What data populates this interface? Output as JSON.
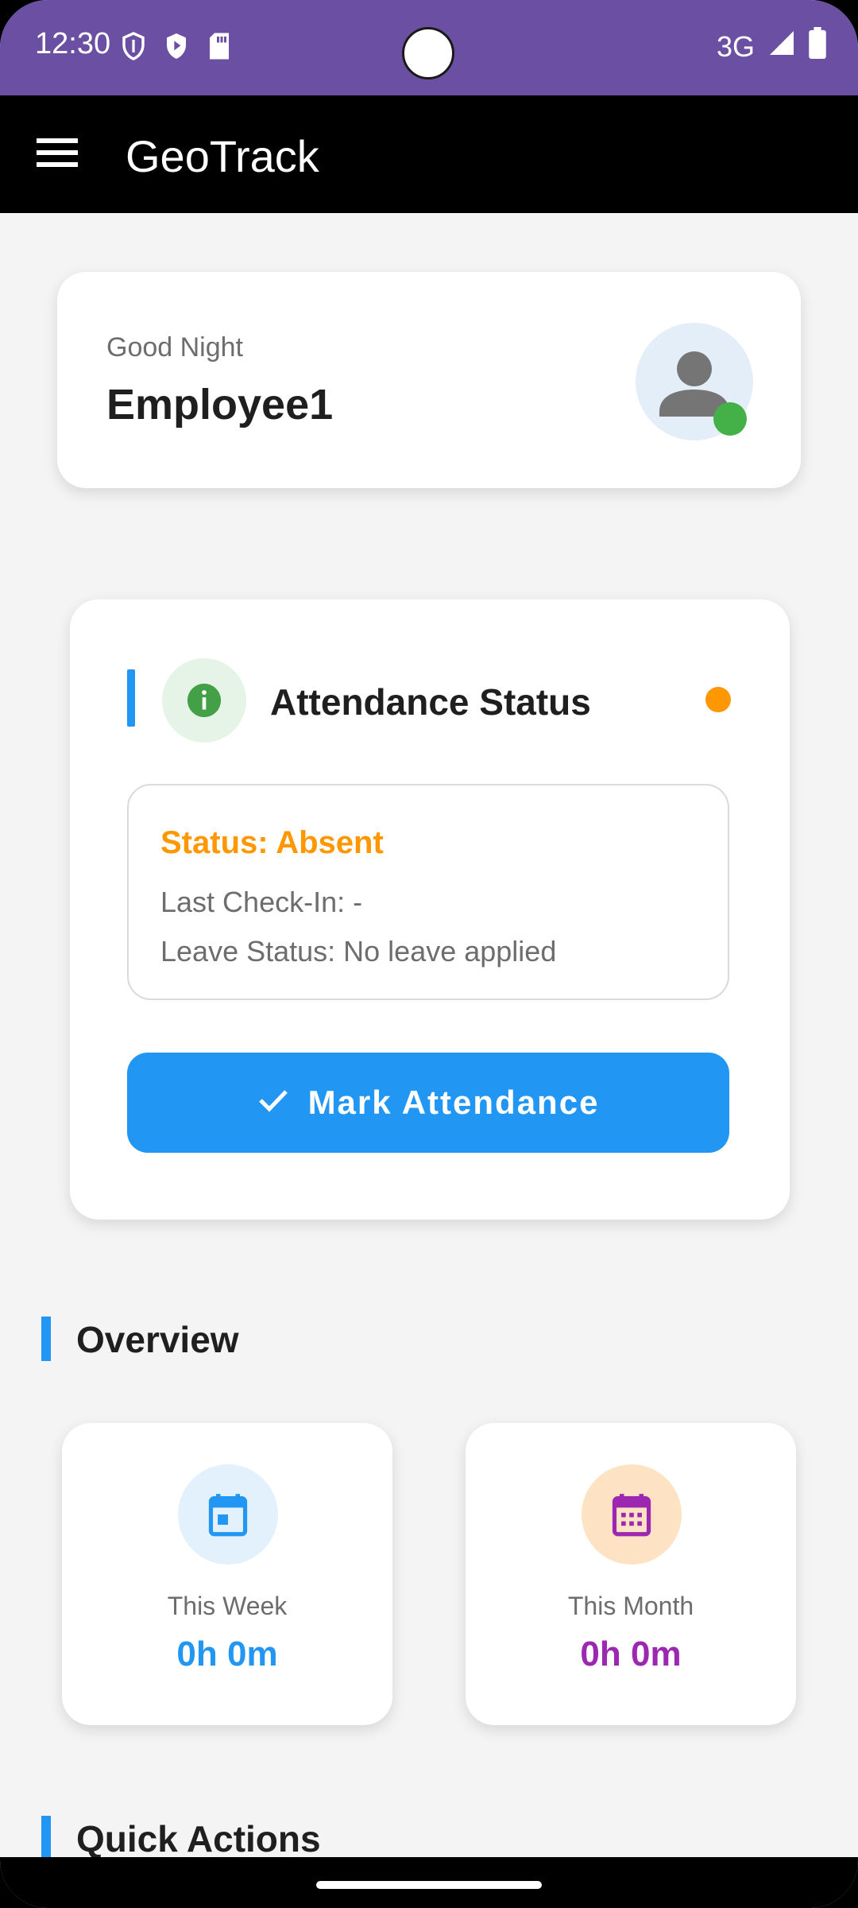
{
  "status_bar": {
    "time": "12:30",
    "network": "3G",
    "icons": [
      "shield-outline-icon",
      "play-shield-icon",
      "sd-card-icon",
      "signal-icon",
      "battery-icon"
    ]
  },
  "app_bar": {
    "title": "GeoTrack",
    "menu_icon": "menu-icon"
  },
  "greeting": {
    "label": "Good Night",
    "name": "Employee1",
    "online_status_color": "#43b048"
  },
  "attendance": {
    "title": "Attendance Status",
    "icon": "info-icon",
    "indicator_color": "#ff9800",
    "status": "Status: Absent",
    "last_check_in": "Last Check-In: -",
    "leave_status": "Leave Status: No leave applied",
    "button_label": "Mark Attendance",
    "button_icon": "check-icon"
  },
  "overview": {
    "title": "Overview",
    "cards": [
      {
        "label": "This Week",
        "value": "0h 0m",
        "color": "#2196f3",
        "icon": "calendar-icon"
      },
      {
        "label": "This Month",
        "value": "0h 0m",
        "color": "#9c27b0",
        "icon": "calendar-month-icon"
      }
    ]
  },
  "quick_actions": {
    "title": "Quick Actions"
  },
  "colors": {
    "status_bar": "#6a4fa3",
    "app_bar": "#000000",
    "accent": "#2196f3",
    "absent": "#ff9800"
  }
}
